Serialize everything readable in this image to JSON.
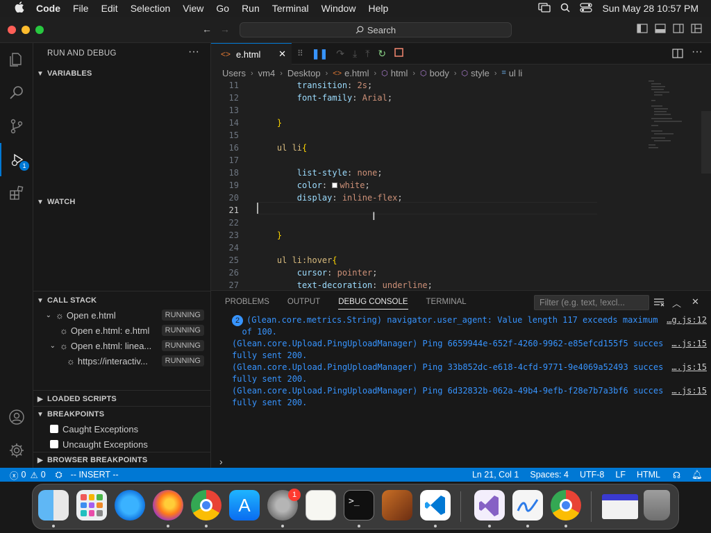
{
  "menubar": {
    "app": "Code",
    "items": [
      "File",
      "Edit",
      "Selection",
      "View",
      "Go",
      "Run",
      "Terminal",
      "Window",
      "Help"
    ],
    "datetime": "Sun May 28  10:57 PM"
  },
  "titlebar": {
    "search": "Search"
  },
  "activity": {
    "debug_badge": "1"
  },
  "sidebar": {
    "title": "RUN AND DEBUG",
    "variables": "VARIABLES",
    "watch": "WATCH",
    "call_stack": "CALL STACK",
    "call_stack_items": [
      {
        "label": "Open e.html",
        "status": "RUNNING"
      },
      {
        "label": "Open e.html: e.html",
        "status": "RUNNING"
      },
      {
        "label": "Open e.html: linea...",
        "status": "RUNNING"
      },
      {
        "label": "https://interactiv...",
        "status": "RUNNING"
      }
    ],
    "loaded_scripts": "LOADED SCRIPTS",
    "breakpoints": "BREAKPOINTS",
    "caught": "Caught Exceptions",
    "uncaught": "Uncaught Exceptions",
    "browser_breakpoints": "BROWSER BREAKPOINTS"
  },
  "editor": {
    "tab": "e.html",
    "breadcrumb": [
      "Users",
      "vm4",
      "Desktop",
      "e.html",
      "html",
      "body",
      "style",
      "ul li"
    ]
  },
  "code_lines": [
    {
      "n": "11",
      "prop": "transition",
      "val": "2s"
    },
    {
      "n": "12",
      "prop": "font-family",
      "val": "Arial"
    },
    {
      "n": "13"
    },
    {
      "n": "14",
      "brace": "}"
    },
    {
      "n": "15"
    },
    {
      "n": "16",
      "sel": "ul li",
      "brace": "{"
    },
    {
      "n": "17"
    },
    {
      "n": "18",
      "prop": "list-style",
      "val": "none"
    },
    {
      "n": "19",
      "prop": "color",
      "val": "white",
      "swatch": "#ffffff"
    },
    {
      "n": "20",
      "prop": "display",
      "val": "inline-flex"
    },
    {
      "n": "21"
    },
    {
      "n": "22"
    },
    {
      "n": "23",
      "brace": "}"
    },
    {
      "n": "24"
    },
    {
      "n": "25",
      "sel": "ul li:hover",
      "brace": "{"
    },
    {
      "n": "26",
      "prop": "cursor",
      "val": "pointer"
    },
    {
      "n": "27",
      "prop": "text-decoration",
      "val": "underline"
    }
  ],
  "panel": {
    "tabs": [
      "PROBLEMS",
      "OUTPUT",
      "DEBUG CONSOLE",
      "TERMINAL"
    ],
    "filter_placeholder": "Filter (e.g. text, !excl...",
    "console": [
      {
        "count": "2",
        "lines": [
          "(Glean.core.metrics.String) navigator.user_agent: Value length 117 exceeds maximum",
          "  of 100."
        ],
        "src": "…g.js:12"
      },
      {
        "lines": [
          "(Glean.core.Upload.PingUploadManager) Ping 6659944e-652f-4260-9962-e85efcd155f5 succes",
          "fully sent 200."
        ],
        "src": "….js:15"
      },
      {
        "lines": [
          "(Glean.core.Upload.PingUploadManager) Ping 33b852dc-e618-4cfd-9771-9e4069a52493 succes",
          "fully sent 200."
        ],
        "src": "….js:15"
      },
      {
        "lines": [
          "(Glean.core.Upload.PingUploadManager) Ping 6d32832b-062a-49b4-9efb-f28e7b7a3bf6 succes",
          "fully sent 200."
        ],
        "src": "….js:15"
      }
    ]
  },
  "status": {
    "errors": "0",
    "warnings": "0",
    "mode": "-- INSERT --",
    "position": "Ln 21, Col 1",
    "spaces": "Spaces: 4",
    "encoding": "UTF-8",
    "eol": "LF",
    "language": "HTML"
  },
  "dock": {
    "settings_badge": "1"
  }
}
